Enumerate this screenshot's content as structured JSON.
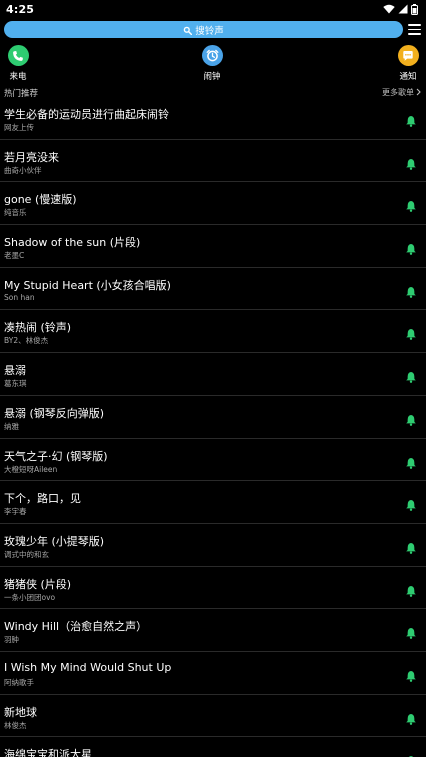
{
  "status_bar": {
    "time": "4:25"
  },
  "search": {
    "label": "搜铃声"
  },
  "categories": [
    {
      "label": "来电",
      "icon": "phone-icon",
      "color": "#2ecc71"
    },
    {
      "label": "闹钟",
      "icon": "alarm-clock-icon",
      "color": "#4aa3e8"
    },
    {
      "label": "通知",
      "icon": "chat-bubble-icon",
      "color": "#f2b01e"
    }
  ],
  "section": {
    "title": "热门推荐",
    "more": "更多歌单"
  },
  "colors": {
    "accent": "#2ecc71",
    "search_bg": "#51b0ee"
  },
  "songs": [
    {
      "title": "学生必备的运动员进行曲起床闹铃",
      "artist": "网友上传"
    },
    {
      "title": "若月亮没来",
      "artist": "曲奇小伙伴"
    },
    {
      "title": "gone (慢速版)",
      "artist": "纯音乐"
    },
    {
      "title": "Shadow of the sun (片段)",
      "artist": "老墨C"
    },
    {
      "title": "My Stupid Heart (小女孩合唱版)",
      "artist": "Son han"
    },
    {
      "title": "凑热闹 (铃声)",
      "artist": "BY2、林俊杰"
    },
    {
      "title": "悬溺",
      "artist": "葛东琪"
    },
    {
      "title": "悬溺 (钢琴反向弹版)",
      "artist": "纳雅"
    },
    {
      "title": "天气之子·幻 (钢琴版)",
      "artist": "大橙短呀Aileen"
    },
    {
      "title": "下个，路口，见",
      "artist": "李宇春"
    },
    {
      "title": "玫瑰少年 (小提琴版)",
      "artist": "调式中的和玄"
    },
    {
      "title": "猪猪侠 (片段)",
      "artist": "一条小团团ovo"
    },
    {
      "title": "Windy Hill（治愈自然之声）",
      "artist": "羽肿"
    },
    {
      "title": "I Wish My Mind Would Shut Up",
      "artist": "阿纳歌手"
    },
    {
      "title": "新地球",
      "artist": "林俊杰"
    },
    {
      "title": "海绵宝宝和派大星",
      "artist": ""
    }
  ]
}
